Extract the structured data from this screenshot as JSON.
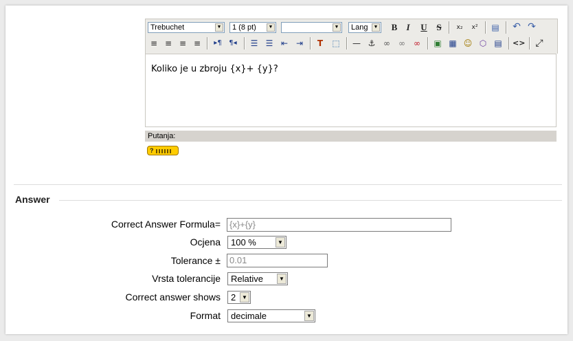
{
  "editor": {
    "font_family": "Trebuchet",
    "font_size": "1 (8 pt)",
    "heading": "",
    "lang": "Lang",
    "content": "Koliko je u zbroju {x}+ {y}?",
    "path_label": "Putanja:",
    "help_badge": "?"
  },
  "answer": {
    "legend": "Answer",
    "formula_label": "Correct Answer Formula=",
    "formula_value": "{x}+{y}",
    "grade_label": "Ocjena",
    "grade_value": "100 %",
    "tolerance_label": "Tolerance ±",
    "tolerance_value": "0.01",
    "tolerance_type_label": "Vrsta tolerancije",
    "tolerance_type_value": "Relative",
    "shows_label": "Correct answer shows",
    "shows_value": "2",
    "format_label": "Format",
    "format_value": "decimale"
  },
  "icons": {
    "bold": "B",
    "italic": "I",
    "underline": "U",
    "strike": "S",
    "subscript": "x₂",
    "superscript": "x²",
    "undo": "↶",
    "redo": "↷",
    "align_left": "≡",
    "align_center": "≡",
    "align_right": "≡",
    "justify": "≡",
    "ltr": "▸¶",
    "rtl": "¶◂",
    "ordered_list": "☰",
    "unordered_list": "☰",
    "outdent": "⇤",
    "indent": "⇥",
    "text_color": "T",
    "bg_color": "⬚",
    "hr": "—",
    "anchor": "⚓",
    "link": "∞",
    "unlink": "∞",
    "nolink": "∞",
    "image": "▣",
    "table": "▦",
    "smiley": "☺",
    "special_char": "⬡",
    "paste_word": "▤",
    "html": "<>",
    "fullscreen": "⤢"
  }
}
